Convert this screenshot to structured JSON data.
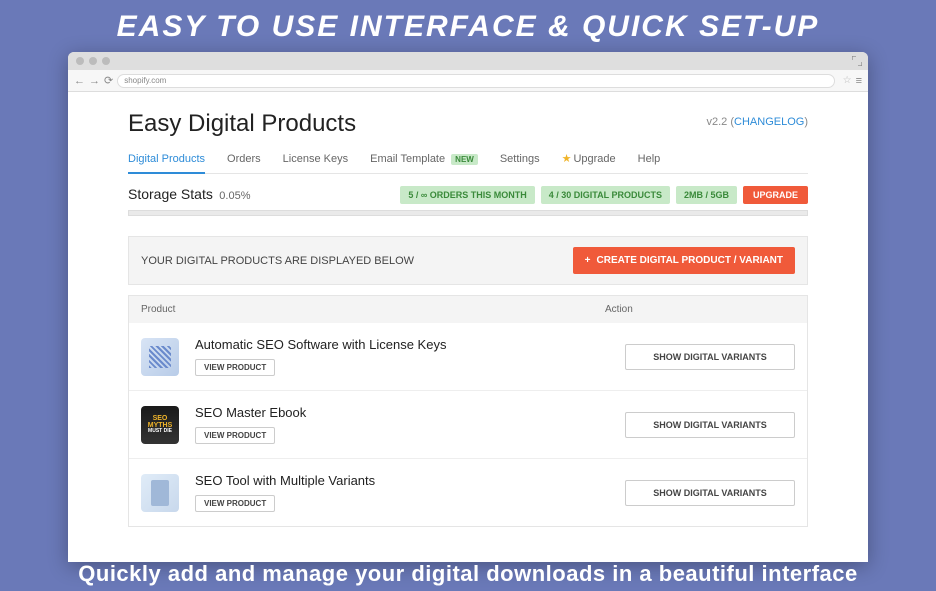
{
  "banner": {
    "top": "EASY TO USE INTERFACE & QUICK SET-UP",
    "bottom": "Quickly add and manage your digital downloads in a beautiful interface"
  },
  "browser": {
    "url": "shopify.com"
  },
  "app": {
    "title": "Easy Digital Products",
    "version": "v2.2",
    "changelog": "CHANGELOG"
  },
  "tabs": {
    "digital_products": "Digital Products",
    "orders": "Orders",
    "license_keys": "License Keys",
    "email_template": "Email Template",
    "new_badge": "NEW",
    "settings": "Settings",
    "upgrade": "Upgrade",
    "help": "Help"
  },
  "storage": {
    "label": "Storage Stats",
    "percent": "0.05%",
    "orders": "5 / ∞ ORDERS THIS MONTH",
    "products": "4 / 30 DIGITAL PRODUCTS",
    "size": "2MB / 5GB",
    "upgrade_btn": "UPGRADE"
  },
  "display": {
    "message": "YOUR DIGITAL PRODUCTS ARE DISPLAYED BELOW",
    "create_btn": "CREATE DIGITAL PRODUCT / VARIANT"
  },
  "table": {
    "col_product": "Product",
    "col_action": "Action",
    "view_btn": "VIEW PRODUCT",
    "show_variants_btn": "SHOW DIGITAL VARIANTS"
  },
  "products": [
    {
      "name": "Automatic SEO Software with License Keys"
    },
    {
      "name": "SEO Master Ebook"
    },
    {
      "name": "SEO Tool with Multiple Variants"
    }
  ]
}
